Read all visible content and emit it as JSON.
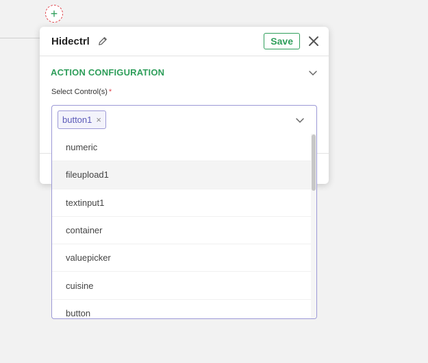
{
  "panel": {
    "title": "Hidectrl",
    "save_label": "Save",
    "section_title": "ACTION CONFIGURATION",
    "field_label": "Select Control(s)",
    "required_mark": "*"
  },
  "select": {
    "selected_tag": "button1",
    "tag_remove": "×",
    "options": [
      "numeric",
      "fileupload1",
      "textinput1",
      "container",
      "valuepicker",
      "cuisine",
      "button"
    ],
    "highlighted_index": 1
  },
  "add_node": {
    "symbol": "+"
  },
  "colors": {
    "accent_green": "#2e9e5a",
    "required_red": "#e0434b",
    "select_border": "#9b98d6",
    "tag_text": "#5a59b8"
  },
  "icons": [
    "plus-icon",
    "pencil-icon",
    "close-icon",
    "chevron-down-icon"
  ]
}
